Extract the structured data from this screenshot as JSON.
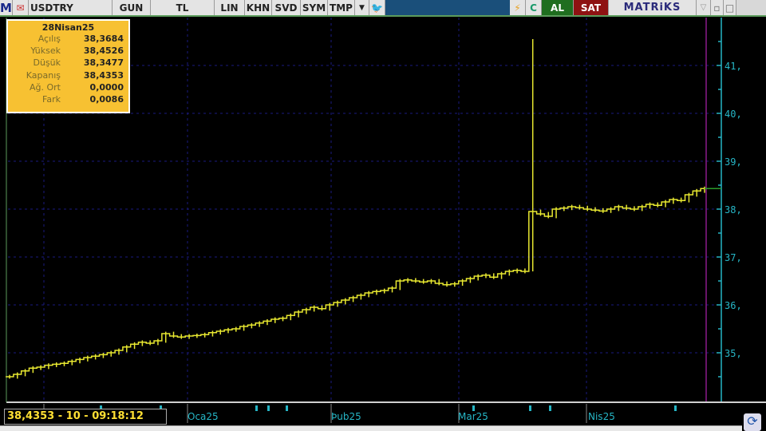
{
  "toolbar": {
    "logo": "M",
    "symbol": "USDTRY",
    "period": "GUN",
    "currency": "TL",
    "scale": "LIN",
    "buttons": [
      "KHN",
      "SVD",
      "SYM",
      "TMP"
    ],
    "al": "AL",
    "sat": "SAT",
    "brand": "MATRiKS",
    "c_label": "C"
  },
  "info": {
    "date": "28Nisan25",
    "rows": [
      {
        "k": "Açılış",
        "v": "38,3684"
      },
      {
        "k": "Yüksek",
        "v": "38,4526"
      },
      {
        "k": "Düşük",
        "v": "38,3477"
      },
      {
        "k": "Kapanış",
        "v": "38,4353"
      },
      {
        "k": "Ağ. Ort",
        "v": "0,0000"
      },
      {
        "k": "Fark",
        "v": "0,0086"
      }
    ]
  },
  "status": "38,4353 - 10 - 09:18:12",
  "colors": {
    "price": "#e8e830",
    "axis": "#26b6c6",
    "grid": "#1a1a80",
    "cursor": "#8a1a8a"
  },
  "chart_data": {
    "type": "line",
    "title": "USDTRY",
    "x_labels": [
      "Oca25",
      "Þub25",
      "Mar25",
      "Nis25"
    ],
    "y_ticks": [
      "35,",
      "36,",
      "37,",
      "38,",
      "39,",
      "40,",
      "41,"
    ],
    "ylim": [
      34,
      42
    ],
    "spike": {
      "index": 67,
      "high": 41.55,
      "low": 36.7
    },
    "closes": [
      34.5,
      34.55,
      34.62,
      34.68,
      34.7,
      34.74,
      34.76,
      34.78,
      34.82,
      34.86,
      34.9,
      34.93,
      34.96,
      35.0,
      35.05,
      35.12,
      35.18,
      35.22,
      35.2,
      35.25,
      35.4,
      35.35,
      35.33,
      35.35,
      35.36,
      35.38,
      35.42,
      35.45,
      35.48,
      35.5,
      35.55,
      35.58,
      35.62,
      35.66,
      35.7,
      35.72,
      35.78,
      35.85,
      35.9,
      35.95,
      35.92,
      36.0,
      36.05,
      36.1,
      36.15,
      36.2,
      36.25,
      36.28,
      36.3,
      36.35,
      36.5,
      36.52,
      36.5,
      36.48,
      36.5,
      36.45,
      36.42,
      36.44,
      36.5,
      36.55,
      36.6,
      36.62,
      36.58,
      36.65,
      36.7,
      36.72,
      36.7,
      37.95,
      37.9,
      37.85,
      38.0,
      38.02,
      38.05,
      38.03,
      38.0,
      37.98,
      37.96,
      38.0,
      38.05,
      38.02,
      38.0,
      38.05,
      38.1,
      38.08,
      38.15,
      38.2,
      38.18,
      38.3,
      38.38,
      38.43
    ]
  }
}
